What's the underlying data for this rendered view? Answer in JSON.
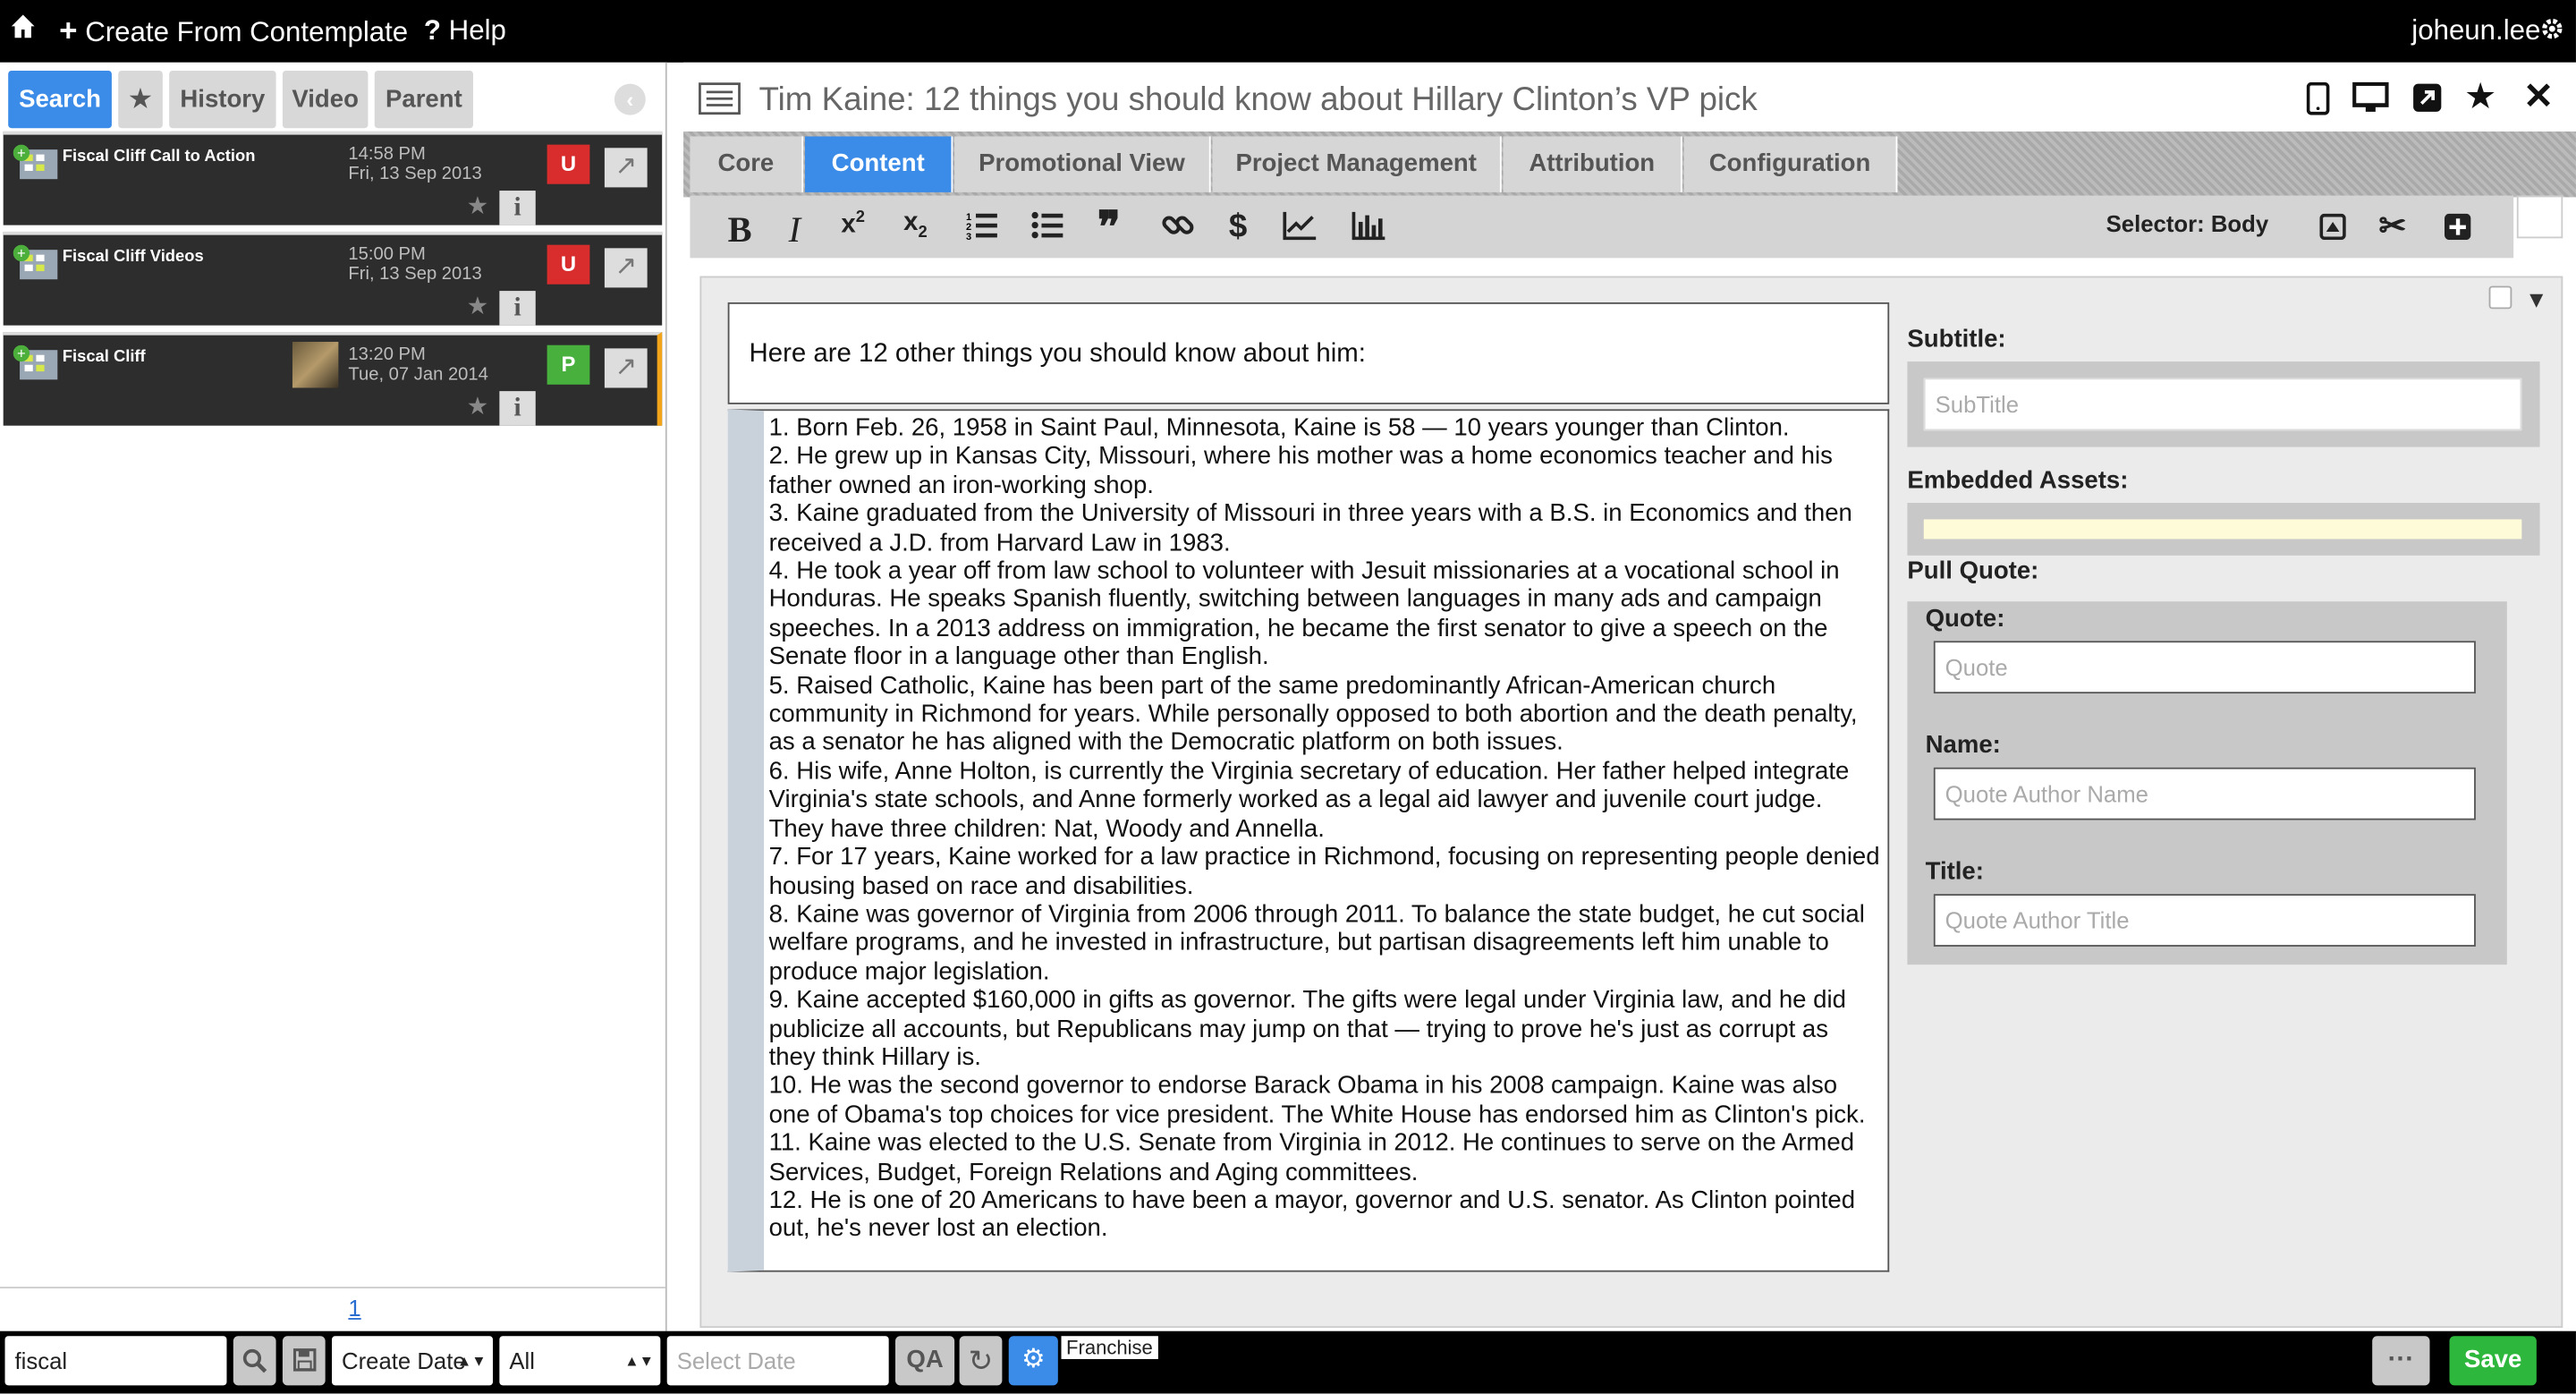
{
  "topbar": {
    "create": "Create From Contemplate",
    "help": "Help",
    "user": "joheun.lee"
  },
  "left_tabs": [
    "Search",
    "★",
    "History",
    "Video",
    "Parent"
  ],
  "results": [
    {
      "title": "Fiscal Cliff Call to Action",
      "time": "14:58 PM",
      "date": "Fri, 13 Sep 2013",
      "status": "U",
      "status_color": "#d92d2d"
    },
    {
      "title": "Fiscal Cliff Videos",
      "time": "15:00 PM",
      "date": "Fri, 13 Sep 2013",
      "status": "U",
      "status_color": "#d92d2d"
    },
    {
      "title": "Fiscal Cliff",
      "time": "13:20 PM",
      "date": "Tue, 07 Jan 2014",
      "status": "P",
      "status_color": "#48b03c"
    }
  ],
  "pagination": "1",
  "bottom": {
    "search_value": "fiscal",
    "sort": "Create Date",
    "filter": "All",
    "date_placeholder": "Select Date",
    "franchise": "Franchise",
    "save": "Save"
  },
  "editor": {
    "title": "Tim Kaine: 12 things you should know about Hillary Clinton’s VP pick",
    "tabs": [
      "Core",
      "Content",
      "Promotional View",
      "Project Management",
      "Attribution",
      "Configuration"
    ],
    "selector": "Selector: Body",
    "intro": "Here are 12 other things you should know about him:",
    "items": [
      "1. Born Feb. 26, 1958 in Saint Paul, Minnesota, Kaine is 58 — 10 years younger than Clinton.",
      "2. He grew up in Kansas City, Missouri, where his mother was a home economics teacher and his father owned an iron-working shop.",
      "3. Kaine graduated from the University of Missouri in three years with a B.S. in Economics and then received a J.D. from Harvard Law in 1983.",
      "4. He took a year off from law school to volunteer with Jesuit missionaries at a vocational school in Honduras. He speaks Spanish fluently, switching between languages in many ads and campaign speeches. In a 2013 address on immigration, he became the first senator to give a speech on the Senate floor in a language other than English.",
      "5. Raised Catholic, Kaine has been part of the same predominantly African-American church community in Richmond for years. While personally opposed to both abortion and the death penalty, as a senator he has aligned with the Democratic platform on both issues.",
      "6. His wife, Anne Holton, is currently the Virginia secretary of education. Her father helped integrate Virginia's state schools, and Anne formerly worked as a legal aid lawyer and juvenile court judge. They have three children: Nat, Woody and Annella.",
      "7. For 17 years, Kaine worked for a law practice in Richmond, focusing on representing people denied housing based on race and disabilities.",
      "8. Kaine was governor of Virginia from 2006 through 2011. To balance the state budget, he cut social welfare programs, and he invested in infrastructure, but partisan disagreements left him unable to produce major legislation.",
      "9. Kaine accepted $160,000 in gifts as governor. The gifts were legal under Virginia law, and he did publicize all accounts, but Republicans may jump on that — trying to prove he's just as corrupt as they think Hillary is.",
      "10. He was the second governor to endorse Barack Obama in his 2008 campaign. Kaine was also one of Obama's top choices for vice president. The White House has endorsed him as Clinton's pick.",
      "11. Kaine was elected to the U.S. Senate from Virginia in 2012. He continues to serve on the Armed Services, Budget, Foreign Relations and Aging committees.",
      "12. He is one of 20 Americans to have been a mayor, governor and U.S. senator. As Clinton pointed out, he's never lost an election."
    ],
    "side": {
      "subtitle_label": "Subtitle:",
      "subtitle_ph": "SubTitle",
      "embedded_label": "Embedded Assets:",
      "pull_label": "Pull Quote:",
      "quote_label": "Quote:",
      "quote_ph": "Quote",
      "name_label": "Name:",
      "name_ph": "Quote Author Name",
      "title_label": "Title:",
      "title_ph": "Quote Author Title"
    }
  }
}
